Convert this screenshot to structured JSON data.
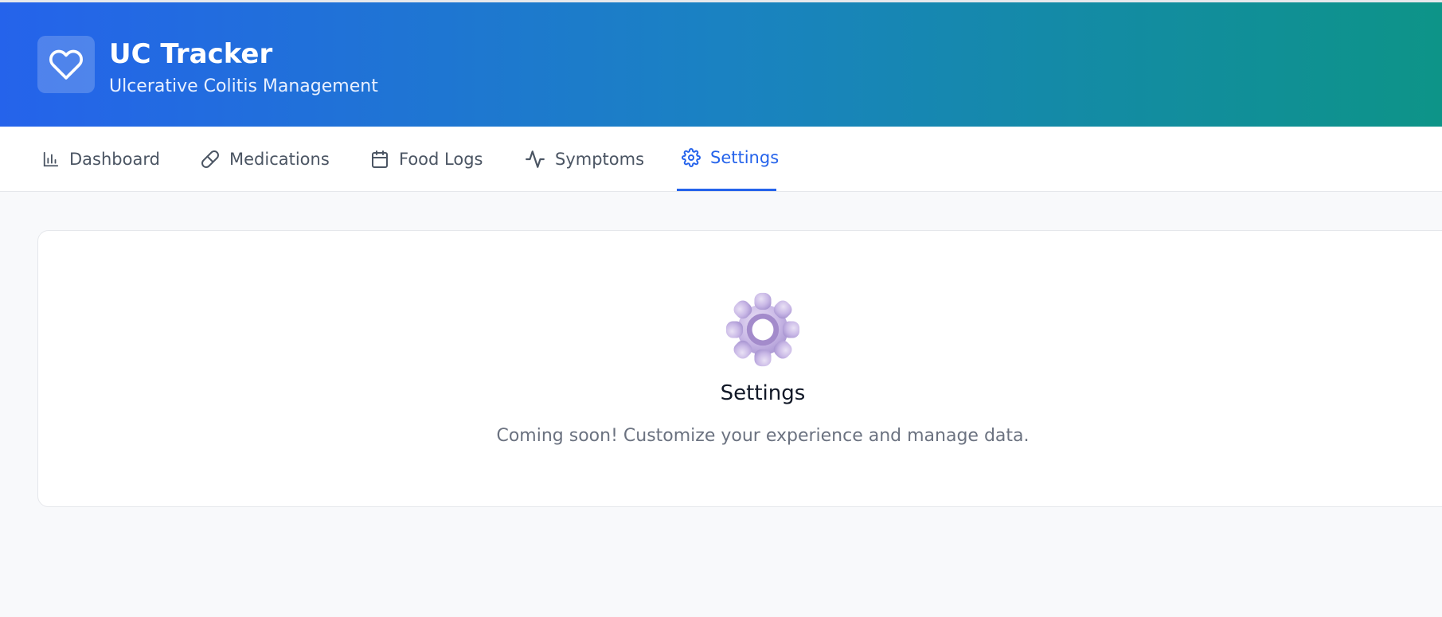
{
  "header": {
    "title": "UC Tracker",
    "subtitle": "Ulcerative Colitis Management",
    "logo_icon": "heart-icon",
    "gradient_start": "#2563eb",
    "gradient_end": "#0d9488"
  },
  "nav": {
    "tabs": [
      {
        "label": "Dashboard",
        "icon": "bar-chart-icon",
        "active": false
      },
      {
        "label": "Medications",
        "icon": "pill-icon",
        "active": false
      },
      {
        "label": "Food Logs",
        "icon": "calendar-icon",
        "active": false
      },
      {
        "label": "Symptoms",
        "icon": "activity-icon",
        "active": false
      },
      {
        "label": "Settings",
        "icon": "gear-icon",
        "active": true
      }
    ],
    "active_color": "#2563eb"
  },
  "main": {
    "emoji": "gear-emoji",
    "title": "Settings",
    "message": "Coming soon! Customize your experience and manage data."
  }
}
